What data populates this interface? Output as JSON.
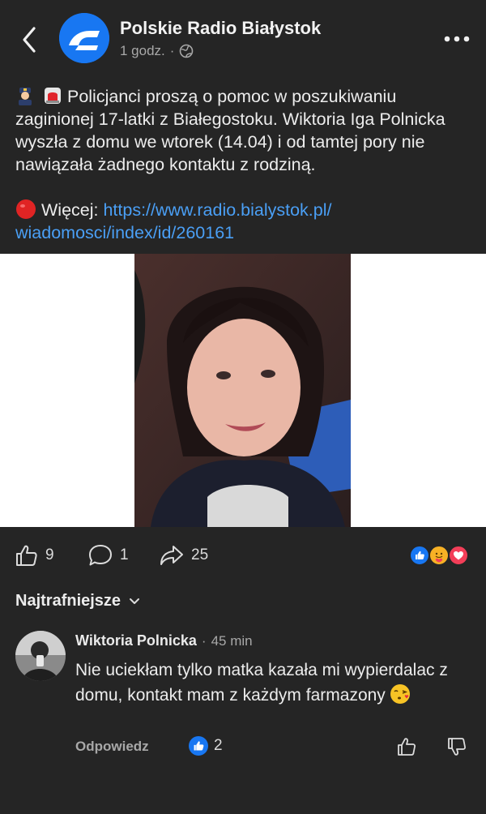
{
  "header": {
    "page_name": "Polskie Radio Białystok",
    "time": "1 godz.",
    "separator": "·",
    "audience_icon": "globe-icon"
  },
  "post": {
    "emojis": [
      "police-officer-emoji",
      "police-light-emoji"
    ],
    "text": "Policjanci proszą o pomoc w poszukiwaniu zaginionej 17-latki z Białegostoku. Wiktoria Iga Polnicka wyszła z domu we wtorek (14.04) i od tamtej pory nie nawiązała żadnego kontaktu z rodziną.",
    "more_label": "Więcej:",
    "link_line1": "https://www.radio.bialystok.pl/",
    "link_line2": "wiadomosci/index/id/260161"
  },
  "actions": {
    "likes": "9",
    "comments": "1",
    "shares": "25",
    "reaction_icons": [
      "like-reaction-icon",
      "care-reaction-icon",
      "love-reaction-icon"
    ]
  },
  "comments_section": {
    "sort_label": "Najtrafniejsze"
  },
  "comment": {
    "author": "Wiktoria Polnicka",
    "dot": "·",
    "time": "45 min",
    "text": "Nie uciekłam tylko matka kazała mi wypierdalac z domu, kontakt mam z każdym farmazony",
    "emoji": "face-blowing-kiss-emoji",
    "reply_label": "Odpowiedz",
    "like_count": "2"
  },
  "colors": {
    "background": "#252525",
    "link": "#4a9ff5",
    "brand": "#1877f2"
  }
}
